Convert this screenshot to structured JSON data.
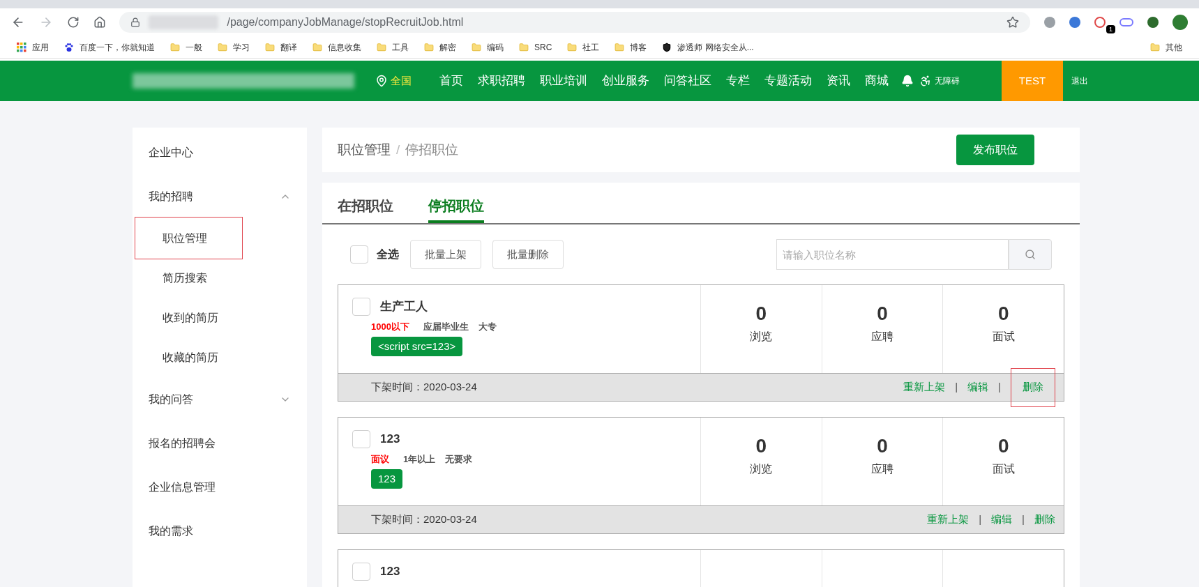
{
  "browser": {
    "url_path": "/page/companyJobManage/stopRecruitJob.html",
    "extension_badge": "1",
    "bookmarks": [
      {
        "label": "应用",
        "kind": "apps"
      },
      {
        "label": "百度一下，你就知道",
        "kind": "paw"
      },
      {
        "label": "一般",
        "kind": "folder"
      },
      {
        "label": "学习",
        "kind": "folder"
      },
      {
        "label": "翻译",
        "kind": "folder"
      },
      {
        "label": "信息收集",
        "kind": "folder"
      },
      {
        "label": "工具",
        "kind": "folder"
      },
      {
        "label": "解密",
        "kind": "folder"
      },
      {
        "label": "编码",
        "kind": "folder"
      },
      {
        "label": "SRC",
        "kind": "folder"
      },
      {
        "label": "社工",
        "kind": "folder"
      },
      {
        "label": "博客",
        "kind": "folder"
      },
      {
        "label": "渗透师 网络安全从...",
        "kind": "shield"
      }
    ],
    "other_bookmarks": "其他"
  },
  "header": {
    "location": "全国",
    "nav": [
      "首页",
      "求职招聘",
      "职业培训",
      "创业服务",
      "问答社区",
      "专栏",
      "专题活动",
      "资讯",
      "商城"
    ],
    "accessibility": "无障碍",
    "user": "TEST",
    "logout": "退出"
  },
  "sidebar": [
    {
      "label": "企业中心"
    },
    {
      "label": "我的招聘",
      "expanded": true,
      "children": [
        {
          "label": "职位管理",
          "highlighted": true
        },
        {
          "label": "简历搜索",
          "highlighted": false
        },
        {
          "label": "收到的简历",
          "highlighted": false
        },
        {
          "label": "收藏的简历",
          "highlighted": false
        }
      ]
    },
    {
      "label": "我的问答",
      "expanded": false
    },
    {
      "label": "报名的招聘会"
    },
    {
      "label": "企业信息管理"
    },
    {
      "label": "我的需求"
    }
  ],
  "breadcrumb": {
    "parent": "职位管理",
    "separator": "/",
    "current": "停招职位"
  },
  "publish_button": "发布职位",
  "tabs": [
    {
      "label": "在招职位",
      "selected": false
    },
    {
      "label": "停招职位",
      "selected": true
    }
  ],
  "toolbar": {
    "select_all": {
      "label": "全选",
      "checked": false
    },
    "buttons": [
      "批量上架",
      "批量删除"
    ],
    "search": {
      "placeholder": "请输入职位名称"
    }
  },
  "jobs": [
    {
      "title": "生产工人",
      "checked": false,
      "salary": "1000以下",
      "experience": "应届毕业生",
      "education": "大专",
      "tags": [
        "<script src=123>"
      ],
      "stats": [
        {
          "value": "0",
          "label": "浏览"
        },
        {
          "value": "0",
          "label": "应聘"
        },
        {
          "value": "0",
          "label": "面试"
        }
      ],
      "off_time": "下架时间：2020-03-24",
      "actions": [
        {
          "kind": "link",
          "label": "重新上架",
          "highlighted": false
        },
        {
          "kind": "separator",
          "label": "|"
        },
        {
          "kind": "link",
          "label": "编辑",
          "highlighted": false
        },
        {
          "kind": "separator",
          "label": "|"
        },
        {
          "kind": "link",
          "label": "删除",
          "highlighted": true
        }
      ]
    },
    {
      "title": "123",
      "checked": false,
      "salary": "面议",
      "experience": "1年以上",
      "education": "无要求",
      "tags": [
        "123"
      ],
      "stats": [
        {
          "value": "0",
          "label": "浏览"
        },
        {
          "value": "0",
          "label": "应聘"
        },
        {
          "value": "0",
          "label": "面试"
        }
      ],
      "off_time": "下架时间：2020-03-24",
      "actions": [
        {
          "kind": "link",
          "label": "重新上架",
          "highlighted": false
        },
        {
          "kind": "separator",
          "label": "|"
        },
        {
          "kind": "link",
          "label": "编辑",
          "highlighted": false
        },
        {
          "kind": "separator",
          "label": "|"
        },
        {
          "kind": "link",
          "label": "删除",
          "highlighted": false
        }
      ]
    },
    {
      "title": "123",
      "checked": false
    }
  ]
}
